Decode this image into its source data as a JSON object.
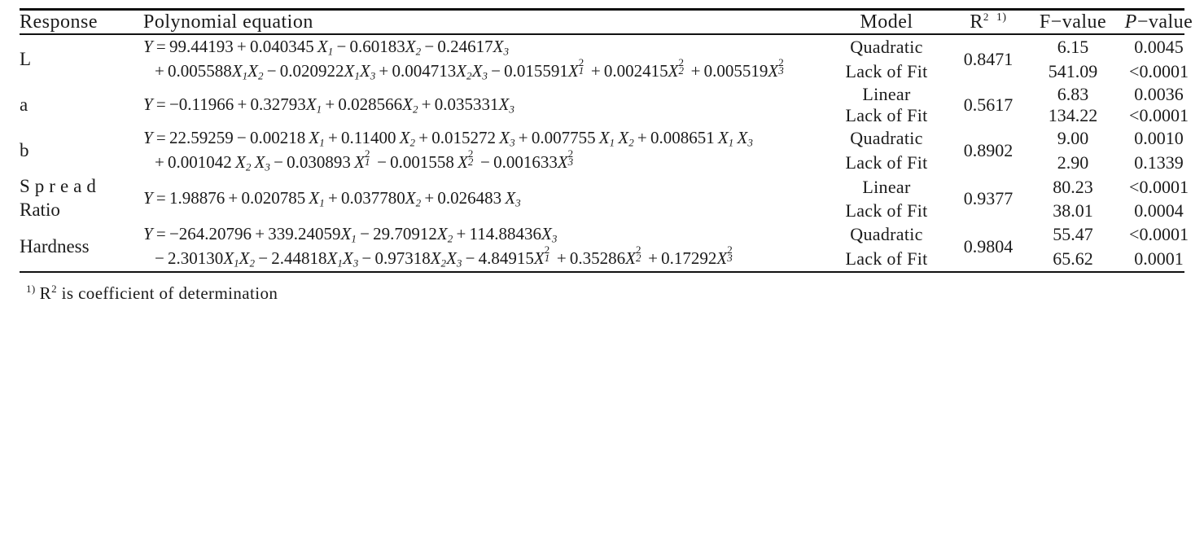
{
  "table": {
    "headers": {
      "response": "Response",
      "equation": "Polynomial equation",
      "model": "Model",
      "r2": "R",
      "r2_exponent": "2",
      "r2_footnote_mark": "1)",
      "f_value": "F−value",
      "p_value_italic": "P",
      "p_value_rest": "−value"
    },
    "rows": [
      {
        "response": "L",
        "equation_lines": [
          "Y = 99.44193 + 0.040345 X₁ − 0.60183X₂ − 0.24617X₃",
          "+ 0.005588X₁X₂ − 0.020922X₁X₃ + 0.004713X₂X₃ − 0.015591X₁² + 0.002415X₂² + 0.005519X₃²"
        ],
        "model": "Quadratic",
        "r2": "0.8471",
        "f_value": "6.15",
        "p_value": "0.0045",
        "lack_of_fit_label": "Lack of Fit",
        "lof_r2": "",
        "lof_f_value": "541.09",
        "lof_p_value": "<0.0001"
      },
      {
        "response": "a",
        "equation_lines": [
          "Y = −0.11966 + 0.32793X₁ + 0.028566X₂ + 0.035331X₃"
        ],
        "model": "Linear",
        "r2": "0.5617",
        "f_value": "6.83",
        "p_value": "0.0036",
        "lack_of_fit_label": "Lack of Fit",
        "lof_r2": "",
        "lof_f_value": "134.22",
        "lof_p_value": "<0.0001"
      },
      {
        "response": "b",
        "equation_lines": [
          "Y = 22.59259 − 0.00218 X₁ + 0.11400 X₂ + 0.015272 X₃ + 0.007755 X₁ X₂ + 0.008651 X₁ X₃",
          "+ 0.001042 X₂ X₃ − 0.030893 X₁² − 0.001558 X₂² − 0.001633X₃²"
        ],
        "model": "Quadratic",
        "r2": "0.8902",
        "f_value": "9.00",
        "p_value": "0.0010",
        "lack_of_fit_label": "Lack of Fit",
        "lof_r2": "",
        "lof_f_value": "2.90",
        "lof_p_value": "0.1339"
      },
      {
        "response": "Spread Ratio",
        "response_line1": "Spread",
        "response_line2": "Ratio",
        "equation_lines": [
          "Y = 1.98876 + 0.020785 X₁ + 0.037780X₂ + 0.026483 X₃"
        ],
        "model": "Linear",
        "r2": "0.9377",
        "f_value": "80.23",
        "p_value": "<0.0001",
        "lack_of_fit_label": "Lack of Fit",
        "lof_r2": "",
        "lof_f_value": "38.01",
        "lof_p_value": "0.0004"
      },
      {
        "response": "Hardness",
        "equation_lines": [
          "Y = −264.20796 + 339.24059X₁ − 29.70912X₂ + 114.88436X₃",
          "− 2.30130X₁X₂ − 2.44818X₁X₃ − 0.97318X₂X₃ − 4.84915X₁² + 0.35286X₂² + 0.17292X₃²"
        ],
        "model": "Quadratic",
        "r2": "0.9804",
        "f_value": "55.47",
        "p_value": "<0.0001",
        "lack_of_fit_label": "Lack of Fit",
        "lof_r2": "",
        "lof_f_value": "65.62",
        "lof_p_value": "0.0001"
      }
    ],
    "footnote": {
      "mark": "1)",
      "symbol": "R",
      "exponent": "2",
      "text": "is  coefficient  of  determination"
    }
  }
}
